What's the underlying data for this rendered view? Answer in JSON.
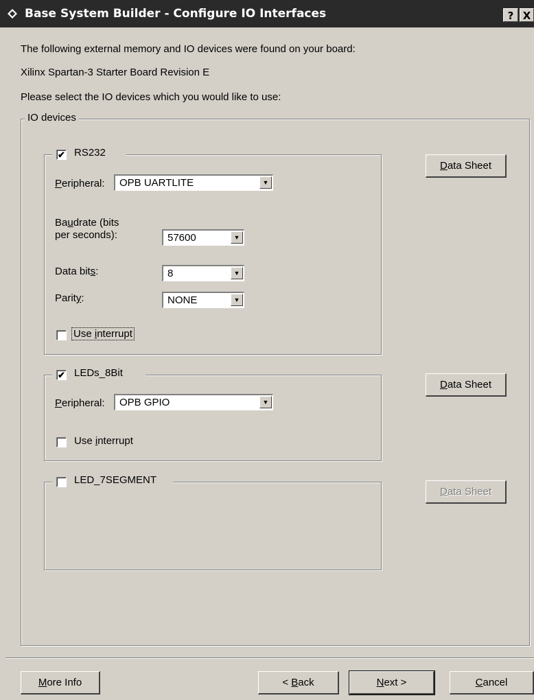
{
  "window": {
    "title": "Base System Builder - Configure IO Interfaces",
    "help_label": "?",
    "close_label": "X"
  },
  "intro": {
    "line1": "The following external memory and IO devices were found on your board:",
    "line2": "Xilinx Spartan-3 Starter Board Revision E",
    "line3": "Please select the IO devices which you would like to use:"
  },
  "io_devices": {
    "group_label": "IO devices",
    "rs232": {
      "enabled": true,
      "label": "RS232",
      "peripheral_label": "Peripheral:",
      "peripheral_value": "OPB UARTLITE",
      "baudrate_label_1": "Baudrate (bits",
      "baudrate_label_2": "per seconds):",
      "baudrate_value": "57600",
      "databits_label": "Data bits:",
      "databits_value": "8",
      "parity_label": "Parity:",
      "parity_value": "NONE",
      "use_interrupt_label": "Use interrupt",
      "use_interrupt": false,
      "datasheet_label": "Data Sheet"
    },
    "leds": {
      "enabled": true,
      "label": "LEDs_8Bit",
      "peripheral_label": "Peripheral:",
      "peripheral_value": "OPB GPIO",
      "use_interrupt_label": "Use interrupt",
      "use_interrupt": false,
      "datasheet_label": "Data Sheet"
    },
    "led7seg": {
      "enabled": false,
      "label": "LED_7SEGMENT",
      "datasheet_label": "Data Sheet"
    }
  },
  "footer": {
    "more_info": "More Info",
    "back": "< Back",
    "next": "Next >",
    "cancel": "Cancel"
  }
}
